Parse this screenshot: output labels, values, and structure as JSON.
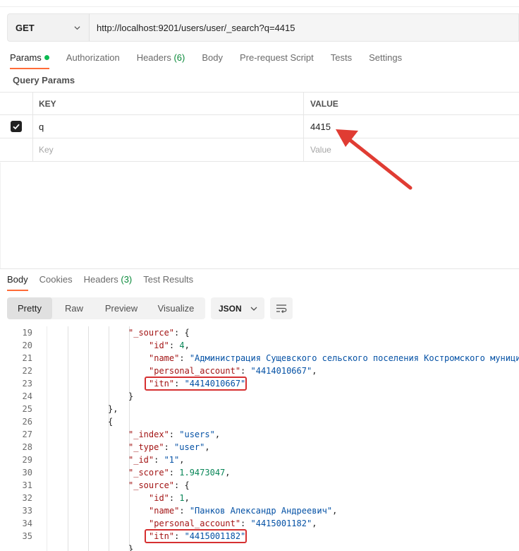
{
  "request": {
    "method": "GET",
    "url": "http://localhost:9201/users/user/_search?q=4415"
  },
  "request_tabs": [
    {
      "label": "Params",
      "active": true,
      "indicator": "green-dot"
    },
    {
      "label": "Authorization"
    },
    {
      "label": "Headers",
      "count": "(6)"
    },
    {
      "label": "Body"
    },
    {
      "label": "Pre-request Script"
    },
    {
      "label": "Tests"
    },
    {
      "label": "Settings"
    }
  ],
  "query_params": {
    "title": "Query Params",
    "columns": {
      "key": "KEY",
      "value": "VALUE"
    },
    "rows": [
      {
        "checked": true,
        "key": "q",
        "value": "4415"
      }
    ],
    "placeholder": {
      "key": "Key",
      "value": "Value"
    }
  },
  "response_tabs": [
    {
      "label": "Body",
      "active": true
    },
    {
      "label": "Cookies"
    },
    {
      "label": "Headers",
      "count": "(3)"
    },
    {
      "label": "Test Results"
    }
  ],
  "view_modes": [
    "Pretty",
    "Raw",
    "Preview",
    "Visualize"
  ],
  "active_view": "Pretty",
  "format": "JSON",
  "code_lines": [
    {
      "n": "19",
      "level": 4,
      "tokens": [
        [
          "k",
          "\"_source\""
        ],
        [
          "p",
          ": {"
        ]
      ]
    },
    {
      "n": "20",
      "level": 5,
      "tokens": [
        [
          "k",
          "\"id\""
        ],
        [
          "p",
          ": "
        ],
        [
          "n",
          "4"
        ],
        [
          "p",
          ","
        ]
      ]
    },
    {
      "n": "21",
      "level": 5,
      "tokens": [
        [
          "k",
          "\"name\""
        ],
        [
          "p",
          ": "
        ],
        [
          "s",
          "\"Администрация Сущевского сельского поселения Костромского муници"
        ]
      ]
    },
    {
      "n": "22",
      "level": 5,
      "tokens": [
        [
          "k",
          "\"personal_account\""
        ],
        [
          "p",
          ": "
        ],
        [
          "s",
          "\"4414010667\""
        ],
        [
          "p",
          ","
        ]
      ]
    },
    {
      "n": "23",
      "level": 5,
      "highlight": true,
      "tokens": [
        [
          "k",
          "\"itn\""
        ],
        [
          "p",
          ": "
        ],
        [
          "s",
          "\"4414010667\""
        ]
      ]
    },
    {
      "n": "24",
      "level": 4,
      "tokens": [
        [
          "p",
          "}"
        ]
      ]
    },
    {
      "n": "25",
      "level": 3,
      "tokens": [
        [
          "p",
          "},"
        ]
      ]
    },
    {
      "n": "26",
      "level": 3,
      "tokens": [
        [
          "p",
          "{"
        ]
      ]
    },
    {
      "n": "27",
      "level": 4,
      "tokens": [
        [
          "k",
          "\"_index\""
        ],
        [
          "p",
          ": "
        ],
        [
          "s",
          "\"users\""
        ],
        [
          "p",
          ","
        ]
      ]
    },
    {
      "n": "28",
      "level": 4,
      "tokens": [
        [
          "k",
          "\"_type\""
        ],
        [
          "p",
          ": "
        ],
        [
          "s",
          "\"user\""
        ],
        [
          "p",
          ","
        ]
      ]
    },
    {
      "n": "29",
      "level": 4,
      "tokens": [
        [
          "k",
          "\"_id\""
        ],
        [
          "p",
          ": "
        ],
        [
          "s",
          "\"1\""
        ],
        [
          "p",
          ","
        ]
      ]
    },
    {
      "n": "30",
      "level": 4,
      "tokens": [
        [
          "k",
          "\"_score\""
        ],
        [
          "p",
          ": "
        ],
        [
          "n",
          "1.9473047"
        ],
        [
          "p",
          ","
        ]
      ]
    },
    {
      "n": "31",
      "level": 4,
      "tokens": [
        [
          "k",
          "\"_source\""
        ],
        [
          "p",
          ": {"
        ]
      ]
    },
    {
      "n": "32",
      "level": 5,
      "tokens": [
        [
          "k",
          "\"id\""
        ],
        [
          "p",
          ": "
        ],
        [
          "n",
          "1"
        ],
        [
          "p",
          ","
        ]
      ]
    },
    {
      "n": "33",
      "level": 5,
      "tokens": [
        [
          "k",
          "\"name\""
        ],
        [
          "p",
          ": "
        ],
        [
          "s",
          "\"Панков Александр Андреевич\""
        ],
        [
          "p",
          ","
        ]
      ]
    },
    {
      "n": "34",
      "level": 5,
      "tokens": [
        [
          "k",
          "\"personal_account\""
        ],
        [
          "p",
          ": "
        ],
        [
          "s",
          "\"4415001182\""
        ],
        [
          "p",
          ","
        ]
      ]
    },
    {
      "n": "35",
      "level": 5,
      "highlight": true,
      "tokens": [
        [
          "k",
          "\"itn\""
        ],
        [
          "p",
          ": "
        ],
        [
          "s",
          "\"4415001182\""
        ]
      ]
    },
    {
      "n": "",
      "level": 4,
      "tokens": [
        [
          "p",
          "}"
        ]
      ]
    }
  ],
  "colors": {
    "accent": "#ff6c37",
    "highlight_box": "#d63031",
    "annotation_arrow": "#e03c33",
    "json_key": "#a31515",
    "json_string": "#0451a5",
    "json_number": "#098658"
  }
}
